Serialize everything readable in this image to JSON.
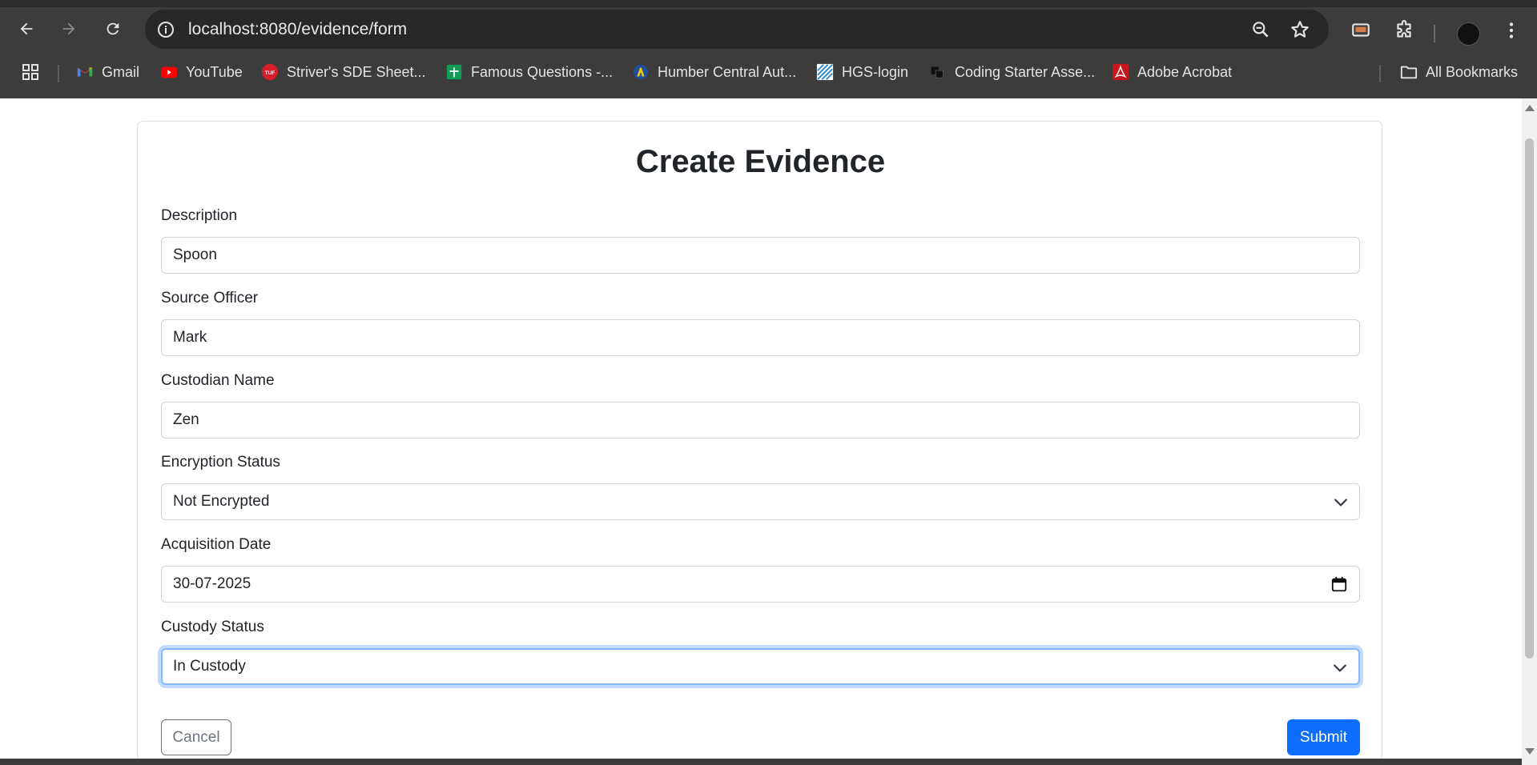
{
  "browser": {
    "url_host": "localhost",
    "url_path": ":8080/evidence/form",
    "bookmarks": [
      {
        "label": "Gmail",
        "icon": "gmail-icon"
      },
      {
        "label": "YouTube",
        "icon": "youtube-icon"
      },
      {
        "label": "Striver's SDE Sheet...",
        "icon": "tuf-icon"
      },
      {
        "label": "Famous Questions -...",
        "icon": "sheets-icon"
      },
      {
        "label": "Humber Central Aut...",
        "icon": "humber-icon"
      },
      {
        "label": "HGS-login",
        "icon": "hgs-icon"
      },
      {
        "label": "Coding Starter Asse...",
        "icon": "coding-icon"
      },
      {
        "label": "Adobe Acrobat",
        "icon": "acrobat-icon"
      }
    ],
    "all_bookmarks_label": "All Bookmarks"
  },
  "form": {
    "title": "Create Evidence",
    "description": {
      "label": "Description",
      "value": "Spoon"
    },
    "source_officer": {
      "label": "Source Officer",
      "value": "Mark"
    },
    "custodian_name": {
      "label": "Custodian Name",
      "value": "Zen"
    },
    "encryption_status": {
      "label": "Encryption Status",
      "value": "Not Encrypted"
    },
    "acquisition_date": {
      "label": "Acquisition Date",
      "value": "30-07-2025"
    },
    "custody_status": {
      "label": "Custody Status",
      "value": "In Custody"
    },
    "cancel_label": "Cancel",
    "submit_label": "Submit"
  },
  "colors": {
    "primary": "#0d6efd",
    "secondary": "#6c757d",
    "focus_ring": "#86b7fe",
    "chrome_bg": "#3c3c3c"
  }
}
